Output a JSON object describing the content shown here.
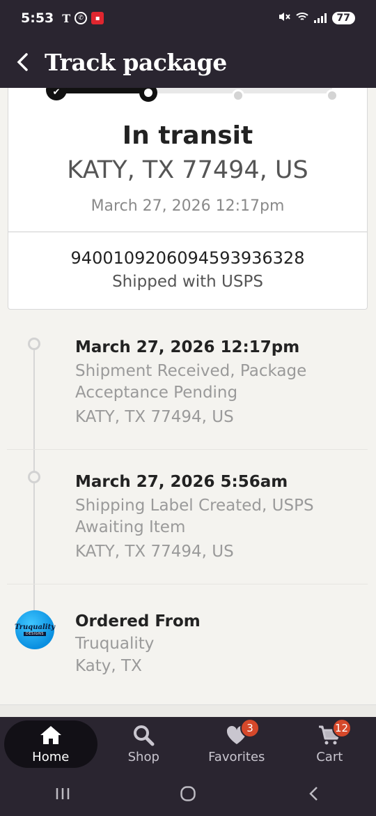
{
  "status_bar": {
    "time": "5:53",
    "carrier_glyph": "T",
    "battery": "77"
  },
  "header": {
    "title": "Track package"
  },
  "summary": {
    "status": "In transit",
    "location": "KATY, TX 77494, US",
    "date": "March 27, 2026 12:17pm",
    "tracking_number": "9400109206094593936328",
    "carrier": "Shipped with USPS"
  },
  "timeline": [
    {
      "date": "March 27, 2026 12:17pm",
      "description": "Shipment Received, Package Acceptance Pending",
      "location": "KATY, TX 77494, US"
    },
    {
      "date": "March 27, 2026 5:56am",
      "description": "Shipping Label Created, USPS Awaiting Item",
      "location": "KATY, TX 77494, US"
    }
  ],
  "origin": {
    "title": "Ordered From",
    "shop_name": "Truquality",
    "shop_location": "Katy, TX",
    "logo_text": "Truquality",
    "logo_subtext": "DESIGNS"
  },
  "bottom_nav": {
    "items": [
      {
        "label": "Home",
        "icon": "home-icon",
        "active": true
      },
      {
        "label": "Shop",
        "icon": "search-icon",
        "active": false
      },
      {
        "label": "Favorites",
        "icon": "heart-icon",
        "badge": "3",
        "active": false
      },
      {
        "label": "Cart",
        "icon": "cart-icon",
        "badge": "12",
        "active": false
      }
    ]
  },
  "colors": {
    "header_bg": "#2a2530",
    "badge": "#d5482a",
    "page_bg": "#f4f3ef"
  }
}
